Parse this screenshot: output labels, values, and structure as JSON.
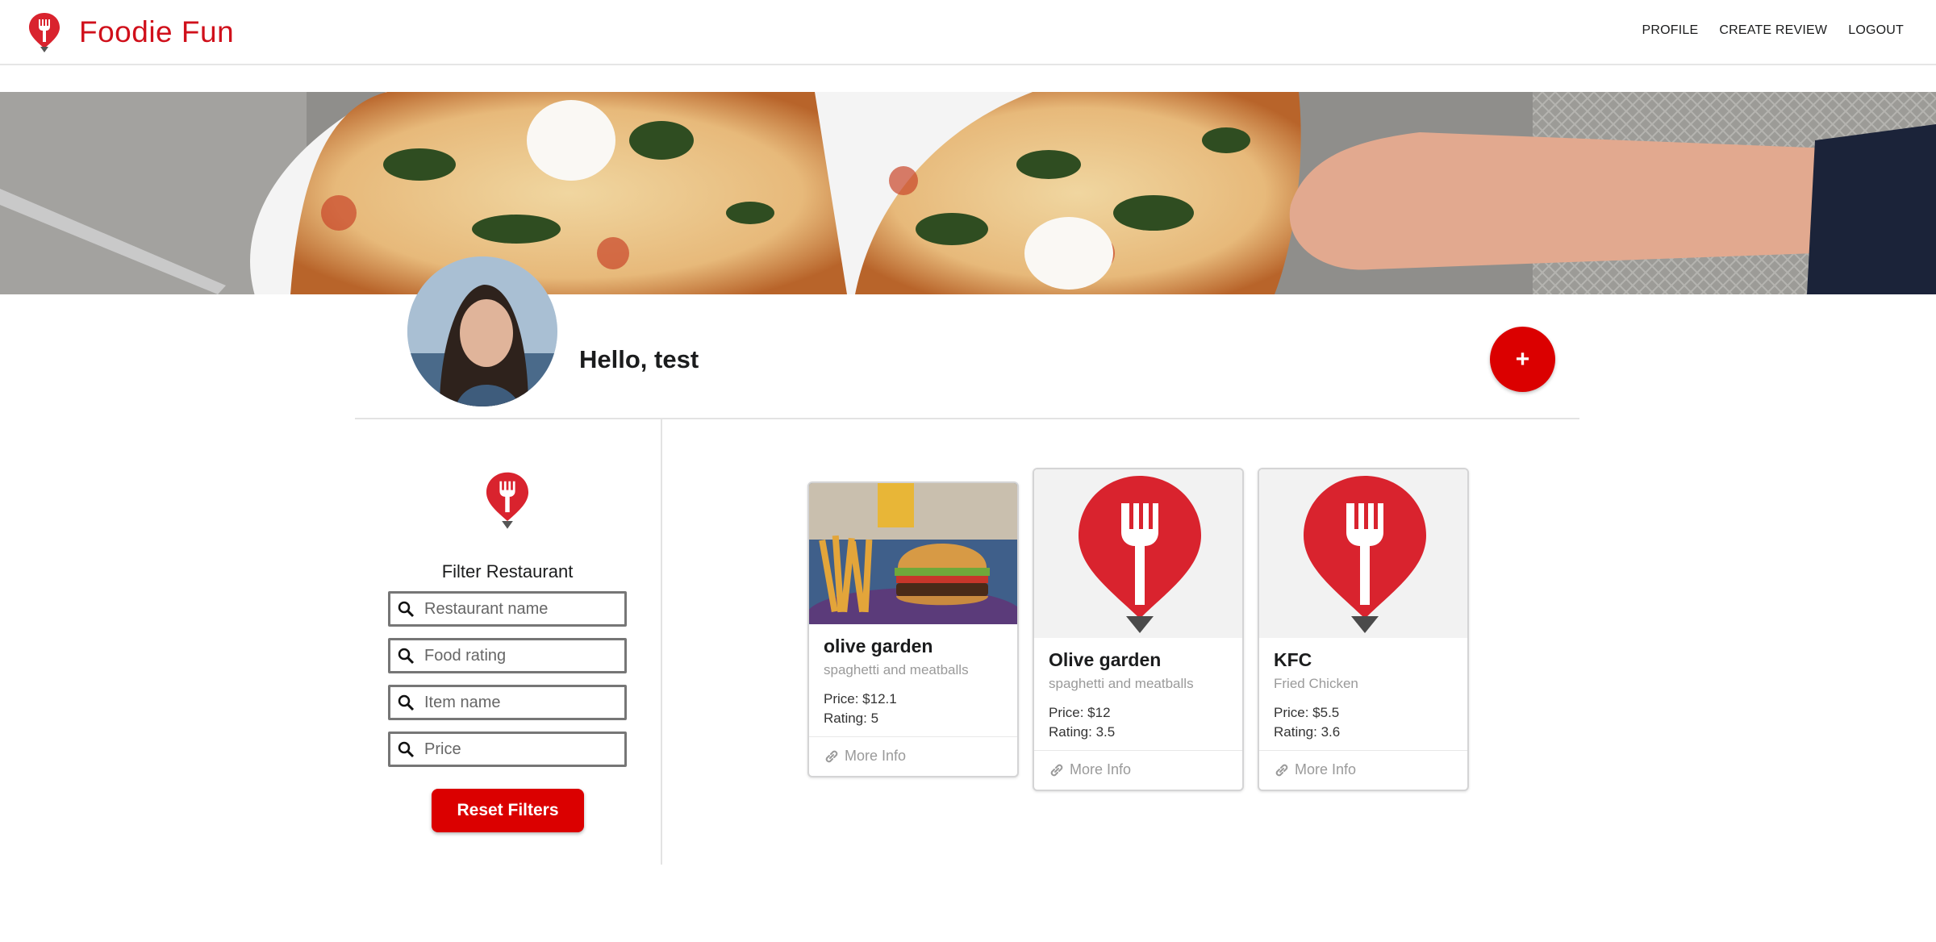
{
  "navbar": {
    "brand_name": "Foodie Fun",
    "links": [
      "PROFILE",
      "CREATE REVIEW",
      "LOGOUT"
    ]
  },
  "profile": {
    "greeting": "Hello, test",
    "add_button_label": "+"
  },
  "filter": {
    "title": "Filter Restaurant",
    "inputs": [
      {
        "placeholder": "Restaurant name"
      },
      {
        "placeholder": "Food rating"
      },
      {
        "placeholder": "Item name"
      },
      {
        "placeholder": "Price"
      }
    ],
    "reset_label": "Reset Filters"
  },
  "cards": [
    {
      "name": "olive garden",
      "item": "spaghetti and meatballs",
      "price": "Price: $12.1",
      "rating": "Rating: 5",
      "link": "More Info",
      "image": "burger-photo"
    },
    {
      "name": "Olive garden",
      "item": "spaghetti and meatballs",
      "price": "Price: $12",
      "rating": "Rating: 3.5",
      "link": "More Info",
      "image": "foodie-logo"
    },
    {
      "name": "KFC",
      "item": "Fried Chicken",
      "price": "Price: $5.5",
      "rating": "Rating: 3.6",
      "link": "More Info",
      "image": "foodie-logo"
    }
  ],
  "colors": {
    "brand_red": "#d0101b",
    "button_red": "#db0000",
    "logo_red": "#d9232e"
  }
}
